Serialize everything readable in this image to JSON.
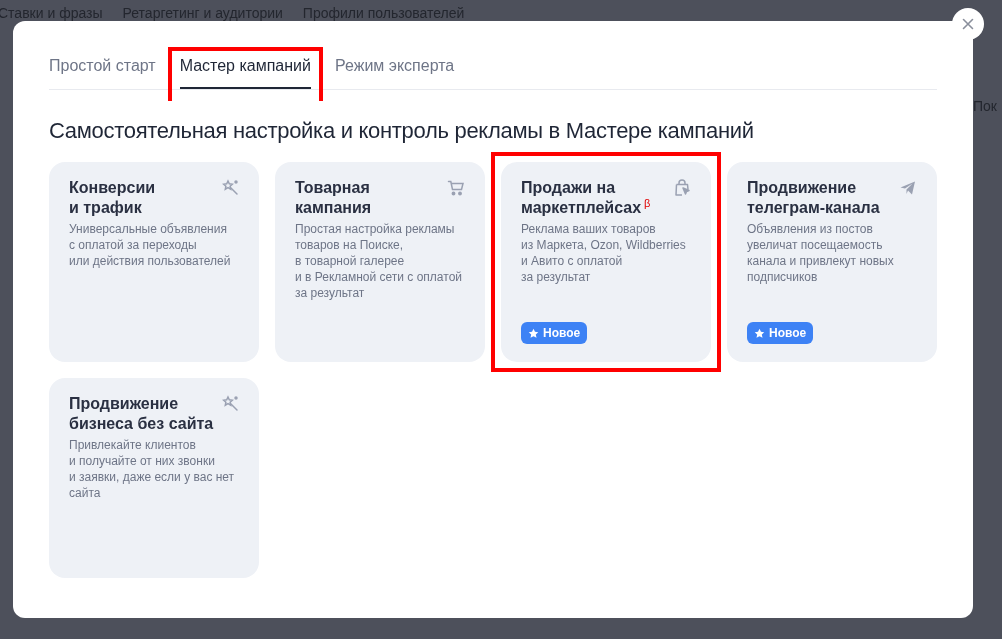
{
  "background": {
    "tabs": [
      "Ставки и фразы",
      "Ретаргетинг и аудитории",
      "Профили пользователей"
    ],
    "side_text": "Пок"
  },
  "modal": {
    "tabs": [
      {
        "label": "Простой старт",
        "selected": false,
        "highlighted": false
      },
      {
        "label": "Мастер кампаний",
        "selected": true,
        "highlighted": true
      },
      {
        "label": "Режим эксперта",
        "selected": false,
        "highlighted": false
      }
    ],
    "heading": "Самостоятельная настройка и контроль рекламы в Мастере кампаний",
    "cards": [
      {
        "title": "Конверсии\nи трафик",
        "kind": "wand",
        "description": "Универсальные объявления\nс оплатой за переходы\nили действия пользователей",
        "highlighted": false
      },
      {
        "title": "Товарная\nкампания",
        "kind": "cart",
        "description": "Простая настройка рекламы\nтоваров на Поиске,\nв товарной галерее\nи в Рекламной сети с оплатой\nза результат",
        "highlighted": false
      },
      {
        "title": "Продажи на\nмаркетплейсах",
        "superscript": "β",
        "kind": "bag",
        "description": "Реклама ваших товаров\nиз Маркета, Ozon, Wildberries\nи Авито с оплатой\nза результат",
        "badge": "Новое",
        "highlighted": true
      },
      {
        "title": "Продвижение\nтелеграм-канала",
        "kind": "plane",
        "description": "Объявления из постов\nувеличат посещаемость\nканала и привлекут новых\nподписчиков",
        "badge": "Новое",
        "highlighted": false
      },
      {
        "title": "Продвижение\nбизнеса без сайта",
        "kind": "wand",
        "description": "Привлекайте клиентов\nи получайте от них звонки\nи заявки, даже если у вас нет\nсайта",
        "highlighted": false
      }
    ]
  }
}
